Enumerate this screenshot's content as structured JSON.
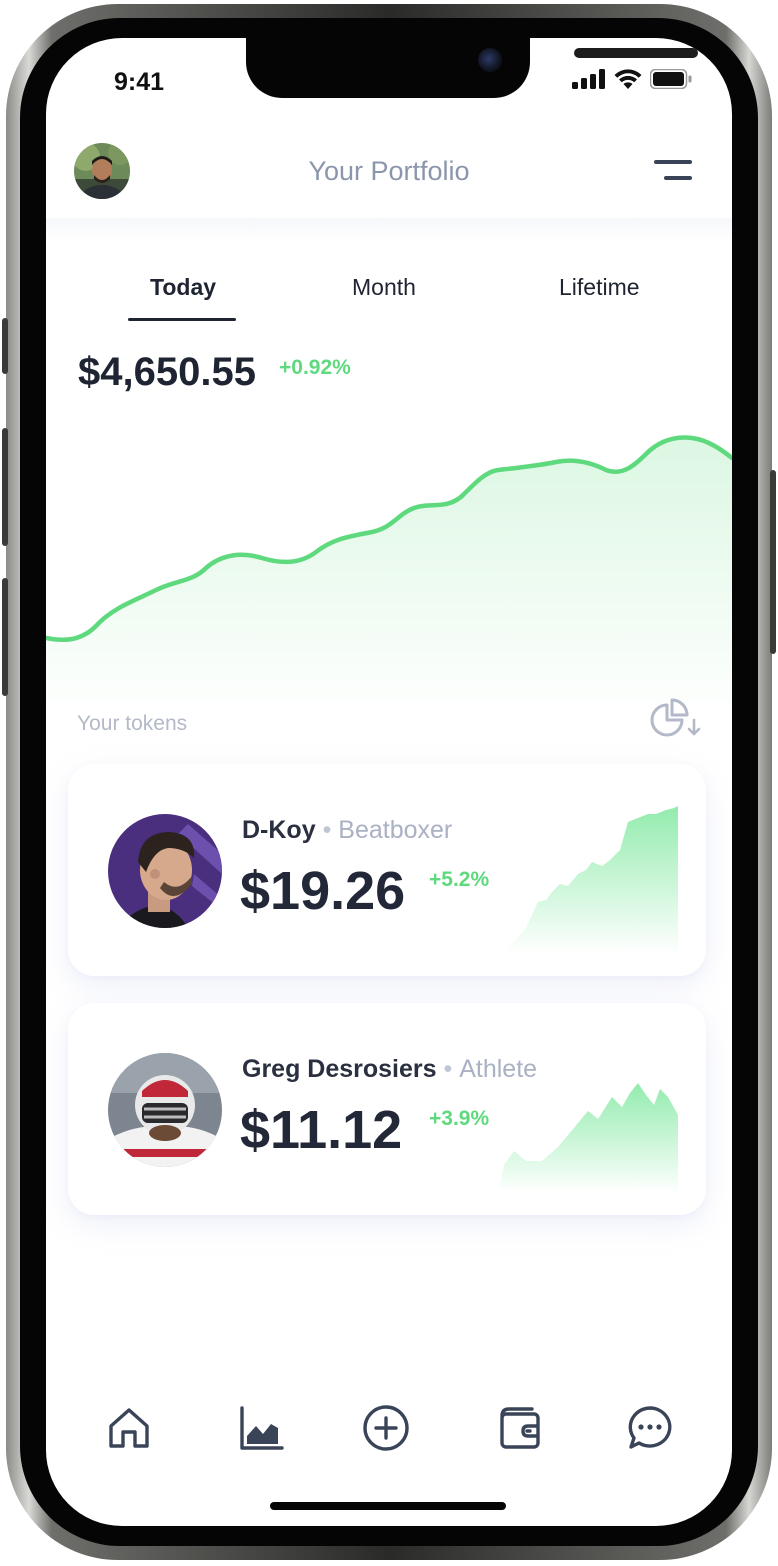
{
  "status_bar": {
    "time": "9:41"
  },
  "header": {
    "title": "Your Portfolio"
  },
  "tabs": [
    {
      "label": "Today",
      "active": true
    },
    {
      "label": "Month",
      "active": false
    },
    {
      "label": "Lifetime",
      "active": false
    }
  ],
  "portfolio": {
    "value": "$4,650.55",
    "change": "+0.92%"
  },
  "section": {
    "tokens_label": "Your tokens"
  },
  "tokens": [
    {
      "name": "D-Koy",
      "separator": "•",
      "role": "Beatboxer",
      "price": "$19.26",
      "change": "+5.2%"
    },
    {
      "name": "Greg Desrosiers",
      "separator": "•",
      "role": "Athlete",
      "price": "$11.12",
      "change": "+3.9%"
    }
  ],
  "nav": [
    {
      "icon": "home-icon"
    },
    {
      "icon": "chart-icon"
    },
    {
      "icon": "plus-circle-icon"
    },
    {
      "icon": "wallet-icon"
    },
    {
      "icon": "chat-icon"
    }
  ],
  "colors": {
    "accent_green": "#5fd97e",
    "title_gray": "#8b96ad",
    "text_dark": "#1f2433",
    "icon_dark": "#3a4458"
  }
}
